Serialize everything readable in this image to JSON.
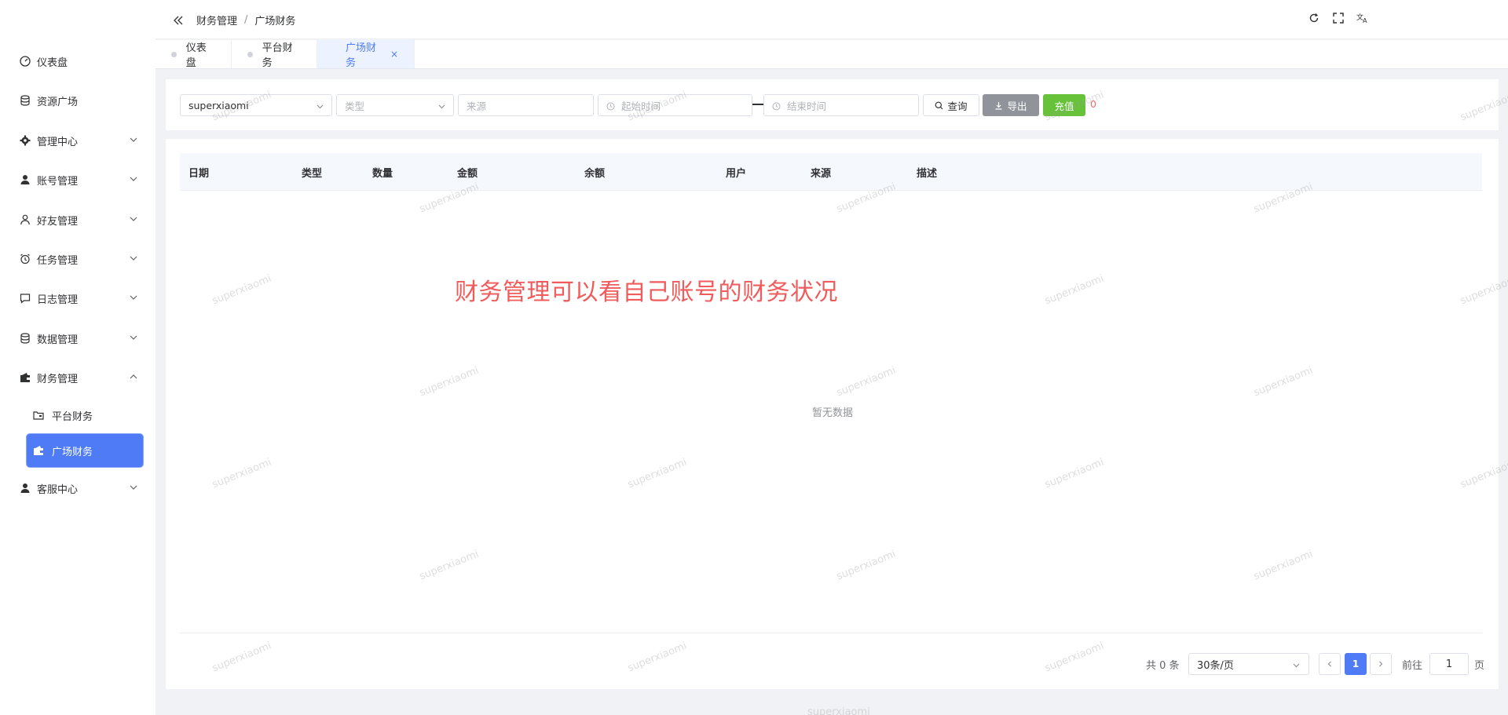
{
  "sidebar": {
    "items": [
      {
        "label": "仪表盘",
        "icon": "dashboard-icon"
      },
      {
        "label": "资源广场",
        "icon": "database-icon"
      },
      {
        "label": "管理中心",
        "icon": "gear-icon"
      },
      {
        "label": "账号管理",
        "icon": "user-solid-icon"
      },
      {
        "label": "好友管理",
        "icon": "user-outline-icon"
      },
      {
        "label": "任务管理",
        "icon": "alarm-clock-icon"
      },
      {
        "label": "日志管理",
        "icon": "chat-bubble-icon"
      },
      {
        "label": "数据管理",
        "icon": "database-icon"
      },
      {
        "label": "财务管理",
        "icon": "wallet-icon"
      },
      {
        "label": "客服中心",
        "icon": "user-solid-icon"
      }
    ],
    "finance_sub": [
      {
        "label": "平台财务",
        "icon": "folder-icon"
      },
      {
        "label": "广场财务",
        "icon": "wallet-icon"
      }
    ]
  },
  "header": {
    "breadcrumb": [
      "财务管理",
      "广场财务"
    ],
    "sep": "/"
  },
  "tabs": [
    {
      "label": "仪表盘"
    },
    {
      "label": "平台财务"
    },
    {
      "label": "广场财务",
      "close": "×"
    }
  ],
  "filters": {
    "account": "superxiaomi",
    "type_placeholder": "类型",
    "source_placeholder": "来源",
    "start_placeholder": "起始时间",
    "end_placeholder": "结束时间",
    "query_label": "查询",
    "export_label": "导出",
    "recharge_label": "充值",
    "balance_badge": "0"
  },
  "table": {
    "columns": [
      "日期",
      "类型",
      "数量",
      "金额",
      "余额",
      "用户",
      "来源",
      "描述"
    ],
    "empty_text": "暂无数据"
  },
  "annotation": "财务管理可以看自己账号的财务状况",
  "pagination": {
    "total": "共 0 条",
    "page_size": "30条/页",
    "current_page": "1",
    "goto_label": "前往",
    "goto_value": "1",
    "page_unit": "页"
  },
  "watermark": "superxiaomi",
  "colors": {
    "primary": "#4f7cf6",
    "success": "#67c23a",
    "info": "#909399",
    "danger": "#f56c6c",
    "annotation": "#f15b5b"
  }
}
